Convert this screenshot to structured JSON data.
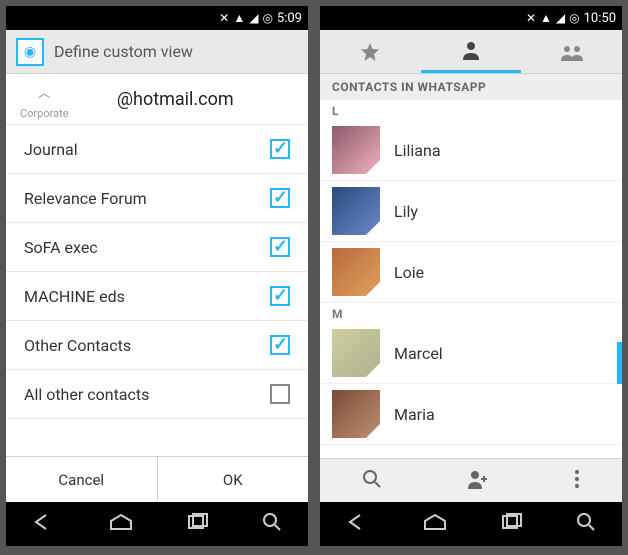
{
  "left": {
    "status_time": "5:09",
    "app_title": "Define custom view",
    "section": {
      "domain": "@hotmail.com",
      "sublabel": "Corporate"
    },
    "rows": [
      {
        "label": "Journal",
        "checked": true
      },
      {
        "label": "Relevance Forum",
        "checked": true
      },
      {
        "label": "SoFA exec",
        "checked": true
      },
      {
        "label": "MACHINE eds",
        "checked": true
      },
      {
        "label": "Other Contacts",
        "checked": true
      },
      {
        "label": "All other contacts",
        "checked": false
      }
    ],
    "buttons": {
      "cancel": "Cancel",
      "ok": "OK"
    }
  },
  "right": {
    "status_time": "10:50",
    "list_header": "CONTACTS IN WHATSAPP",
    "groups": [
      {
        "letter": "L",
        "items": [
          "Liliana",
          "Lily",
          "Loie"
        ]
      },
      {
        "letter": "M",
        "items": [
          "Marcel",
          "Maria"
        ]
      }
    ]
  }
}
